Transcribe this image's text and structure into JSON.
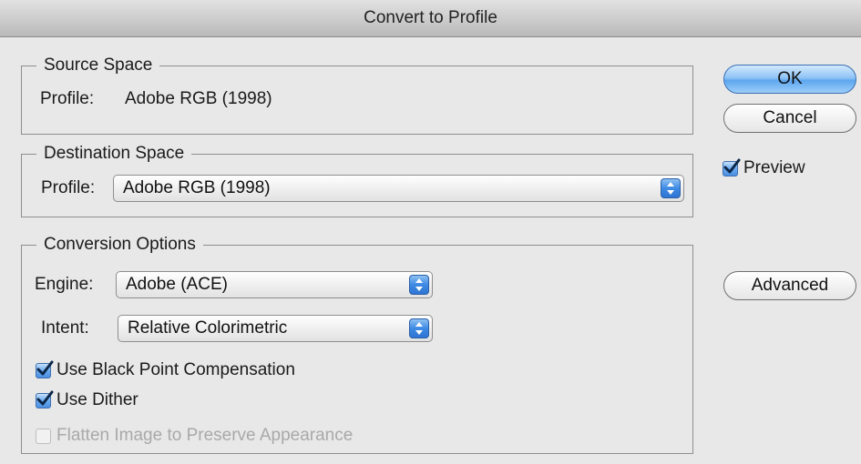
{
  "window": {
    "title": "Convert to Profile"
  },
  "source_space": {
    "legend": "Source Space",
    "profile_label": "Profile:",
    "profile_value": "Adobe RGB (1998)"
  },
  "destination_space": {
    "legend": "Destination Space",
    "profile_label": "Profile:",
    "profile_value": "Adobe RGB (1998)"
  },
  "conversion_options": {
    "legend": "Conversion Options",
    "engine_label": "Engine:",
    "engine_value": "Adobe (ACE)",
    "intent_label": "Intent:",
    "intent_value": "Relative Colorimetric",
    "black_point_label": "Use Black Point Compensation",
    "black_point_checked": true,
    "dither_label": "Use Dither",
    "dither_checked": true,
    "flatten_label": "Flatten Image to Preserve Appearance",
    "flatten_checked": false,
    "flatten_enabled": false
  },
  "buttons": {
    "ok": "OK",
    "cancel": "Cancel",
    "advanced": "Advanced"
  },
  "preview": {
    "label": "Preview",
    "checked": true
  },
  "colors": {
    "accent": "#5da6ef",
    "disabled_text": "#a9a9a9"
  },
  "icons": {
    "popup_arrows": "up-down-arrows-icon",
    "checkmark": "checkmark-icon"
  }
}
